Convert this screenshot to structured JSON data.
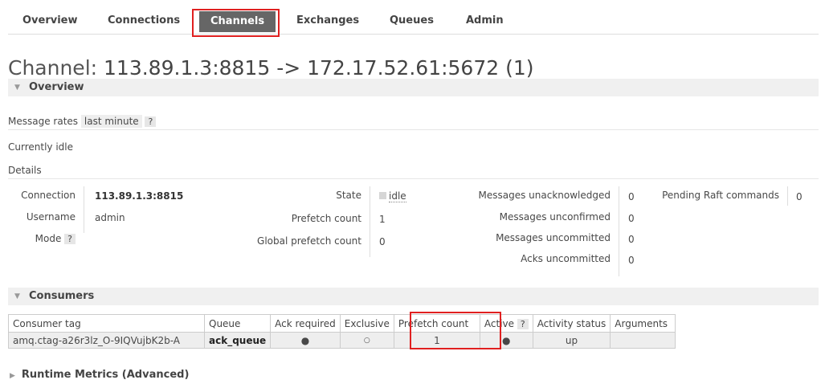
{
  "nav": {
    "tabs": [
      "Overview",
      "Connections",
      "Channels",
      "Exchanges",
      "Queues",
      "Admin"
    ],
    "active": "Channels"
  },
  "title": {
    "prefix": "Channel:",
    "value": "113.89.1.3:8815 -> 172.17.52.61:5672 (1)"
  },
  "overview": {
    "heading": "Overview",
    "message_rates_label": "Message rates",
    "message_rates_period": "last minute",
    "help": "?",
    "status": "Currently idle",
    "details_label": "Details",
    "connection_label": "Connection",
    "connection_value": "113.89.1.3:8815",
    "username_label": "Username",
    "username_value": "admin",
    "mode_label": "Mode",
    "state_label": "State",
    "state_value": "idle",
    "prefetch_label": "Prefetch count",
    "prefetch_value": "1",
    "global_prefetch_label": "Global prefetch count",
    "global_prefetch_value": "0",
    "msg_unacked_label": "Messages unacknowledged",
    "msg_unacked_value": "0",
    "msg_unconfirmed_label": "Messages unconfirmed",
    "msg_unconfirmed_value": "0",
    "msg_uncommitted_label": "Messages uncommitted",
    "msg_uncommitted_value": "0",
    "acks_uncommitted_label": "Acks uncommitted",
    "acks_uncommitted_value": "0",
    "pending_raft_label": "Pending Raft commands",
    "pending_raft_value": "0"
  },
  "consumers": {
    "heading": "Consumers",
    "columns": [
      "Consumer tag",
      "Queue",
      "Ack required",
      "Exclusive",
      "Prefetch count",
      "Active",
      "Activity status",
      "Arguments"
    ],
    "active_help": "?",
    "row": {
      "tag": "amq.ctag-a26r3lz_O-9IQVujbK2b-A",
      "queue": "ack_queue",
      "ack_required": "●",
      "exclusive": "○",
      "prefetch": "1",
      "active": "●",
      "activity_status": "up",
      "arguments": ""
    }
  },
  "runtime_metrics": {
    "label": "Runtime Metrics (Advanced)"
  }
}
